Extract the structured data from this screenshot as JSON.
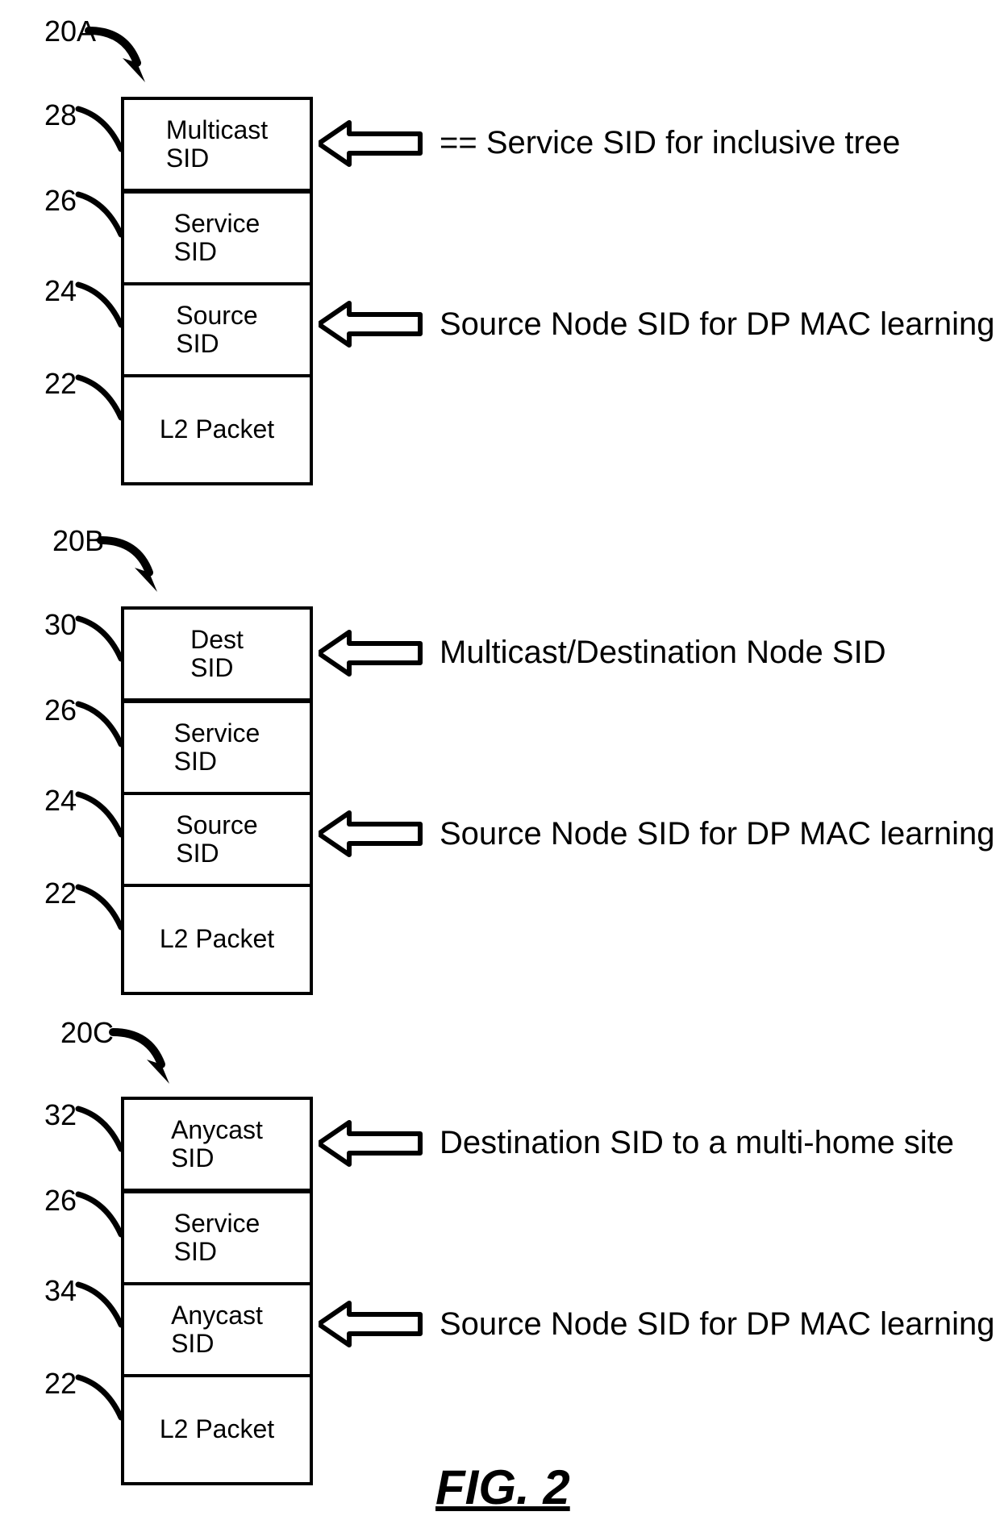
{
  "figure_label": "FIG. 2",
  "stacks": {
    "a": {
      "ref": "20A",
      "cells": [
        "Multicast\nSID",
        "Service\nSID",
        "Source\nSID",
        "L2 Packet"
      ],
      "left_refs": [
        "28",
        "26",
        "24",
        "22"
      ],
      "annotations": {
        "top": "== Service SID for inclusive tree",
        "source": "Source Node SID for DP MAC learning"
      }
    },
    "b": {
      "ref": "20B",
      "cells": [
        "Dest\nSID",
        "Service\nSID",
        "Source\nSID",
        "L2 Packet"
      ],
      "left_refs": [
        "30",
        "26",
        "24",
        "22"
      ],
      "annotations": {
        "top": "Multicast/Destination Node SID",
        "source": "Source Node SID for DP MAC learning"
      }
    },
    "c": {
      "ref": "20C",
      "cells": [
        "Anycast\nSID",
        "Service\nSID",
        "Anycast\nSID",
        "L2 Packet"
      ],
      "left_refs": [
        "32",
        "26",
        "34",
        "22"
      ],
      "annotations": {
        "top": "Destination SID to a multi-home site",
        "source": "Source Node SID for DP MAC learning"
      }
    }
  }
}
